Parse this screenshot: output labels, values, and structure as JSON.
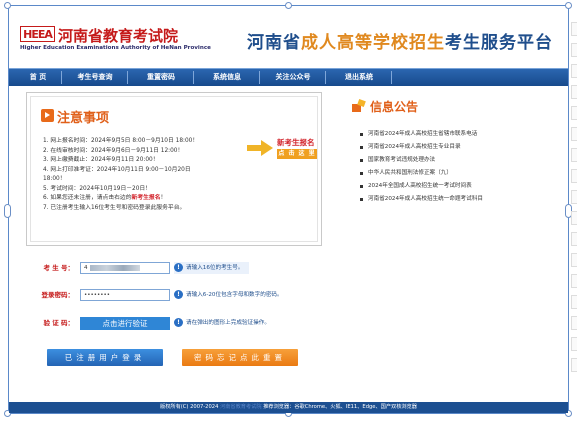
{
  "header": {
    "logo_mark": "HEEA",
    "logo_title": "河南省教育考试院",
    "logo_subtitle": "Higher Education Examinations Authority of HeNan Province",
    "platform_title_a": "河南省",
    "platform_title_b": "成人高等学校招生",
    "platform_title_c": "考生服务平台"
  },
  "nav": {
    "items": [
      "首 页",
      "考生号查询",
      "重置密码",
      "系统信息",
      "关注公众号",
      "退出系统"
    ]
  },
  "notice": {
    "title": "注意事项",
    "items": [
      "1. 网上报名时间：2024年9月5日 8:00－9月10日 18:00！",
      "2. 在线审核时间：2024年9月6日－9月11日 12:00！",
      "3. 网上缴费截止：2024年9月11日 20:00！",
      "4. 网上打印准考证：2024年10月11日 9:00－10月20日",
      "    18:00！",
      "5. 考试时间：2024年10月19日－20日！",
      "6. 如果您还未注册，请点击右边的",
      "7. 已注册考生输入16位考生号和密码登录此服务平台。"
    ],
    "item6_highlight": "新考生报名",
    "item6_tail": "！",
    "new_register": "新考生报名",
    "click_here": "点 击 这 里"
  },
  "bulletin": {
    "title": "信息公告",
    "items": [
      "河南省2024年成人高校招生省辖市联系电话",
      "河南省2024年成人高校招生专业目录",
      "国家教育考试违规处理办法",
      "中华人民共和国刑法修正案（九）",
      "2024年全国成人高校招生统一考试时间表",
      "河南省2024年成人高校招生统一命题考试科目"
    ]
  },
  "form": {
    "exam_no_label": "考 生 号：",
    "exam_no_value": "4",
    "exam_no_hint": "请输入16位的考生号。",
    "password_label": "登录密码：",
    "password_value": "••••••••",
    "password_hint": "请输入6-20位包含字母和数字的密码。",
    "captcha_label": "验 证 码：",
    "captcha_button": "点击进行验证",
    "captcha_hint": "请在弹出的图形上完成验证操作。",
    "login_button": "已注册用户登录",
    "forgot_button": "密码忘记点此重置"
  },
  "footer": {
    "text_a": "版权所有(C) 2007-2024",
    "text_hl": "河南省教育考试院",
    "text_b": "推荐浏览器：谷歌Chrome、火狐、IE11、Edge、国产双核浏览器"
  },
  "colors": {
    "nav_bg": "#1f56a0",
    "brand_red": "#c51a1a",
    "accent_orange": "#e0601a",
    "footer_bg": "#1c4f91"
  }
}
